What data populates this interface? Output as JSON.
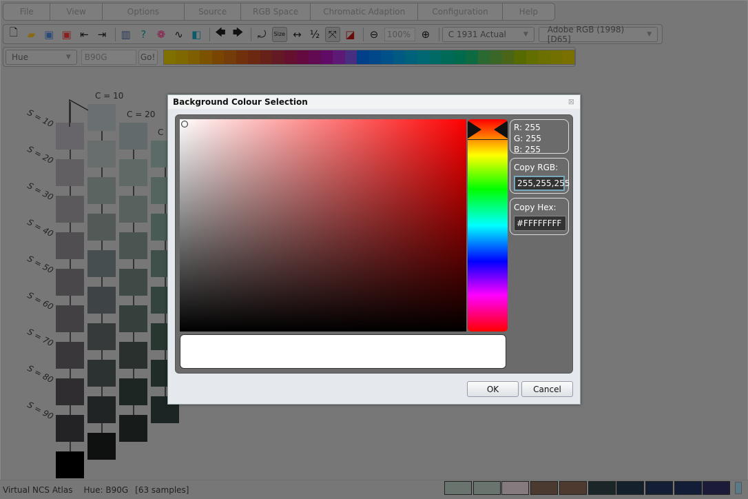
{
  "menu": [
    "File",
    "View",
    "Options",
    "Source",
    "RGB Space",
    "Chromatic Adaption",
    "Configuration",
    "Help"
  ],
  "toolbar": {
    "icons": [
      "new-file-icon",
      "open-folder-icon",
      "save-icon",
      "close-file-icon",
      "import-icon",
      "export-icon",
      "book-icon",
      "help-icon",
      "color-wheel-icon",
      "curve-icon",
      "split-swatch-icon",
      "arrow-left-icon",
      "arrow-right-icon",
      "rotate-icon",
      "size-icon",
      "fit-width-icon",
      "half-icon",
      "fullscreen-icon",
      "color-stack-icon",
      "zoom-out-icon",
      "zoom-in-icon"
    ],
    "zoom": "100%",
    "observer": "C 1931 Actual",
    "rgb_space": "Adobe RGB (1998) [D65]"
  },
  "hue_row": {
    "mode": "Hue",
    "value": "B90G",
    "go": "Go!",
    "strip": [
      "#807000",
      "#806800",
      "#7e5e00",
      "#7c5200",
      "#784600",
      "#743c08",
      "#70300c",
      "#6c2810",
      "#662218",
      "#641a24",
      "#64102e",
      "#640a40",
      "#620a52",
      "#600c66",
      "#5e1876",
      "#482e80",
      "#00408a",
      "#00488a",
      "#00508a",
      "#005a82",
      "#00627a",
      "#006872",
      "#006a66",
      "#006a58",
      "#006a4c",
      "#0e6a40",
      "#2a6a32",
      "#3a6628",
      "#4a6418",
      "#566a00",
      "#626e00",
      "#6c7000",
      "#727000",
      "#7a7000"
    ]
  },
  "atlas": {
    "c_labels": [
      "C = 10",
      "C = 20",
      "C"
    ],
    "s_labels": [
      "S = 10",
      "S = 20",
      "S = 30",
      "S = 40",
      "S = 50",
      "S = 60",
      "S = 70",
      "S = 80",
      "S = 90"
    ],
    "columns": [
      [
        "#676569",
        "#625f63",
        "#5c595d",
        "#514e52",
        "#4a474b",
        "#434044",
        "#3a373b",
        "#2f2d30",
        "#232225",
        "#000000"
      ],
      [
        "#6a6f71",
        "#686e6e",
        "#5c6461",
        "#525957",
        "#474e4f",
        "#3e4346",
        "#363a3a",
        "#2c3131",
        "#202424",
        "#0f1110"
      ],
      [
        "#626a6b",
        "#5f6966",
        "#58615e",
        "#4a5552",
        "#3f4946",
        "#353f3b",
        "#29302e",
        "#1e2624",
        "#171c1b"
      ],
      [
        "#5b6b67",
        "#546560",
        "#495b55",
        "#3f504a",
        "#33433e",
        "#28372f",
        "#1f2c28",
        "#1b2624"
      ]
    ]
  },
  "status": {
    "app": "Virtual NCS Atlas",
    "hue": "Hue: B90G",
    "samples": "[63 samples]",
    "swatches": [
      "#6a746e",
      "#6a746e",
      "#857a7d",
      "#4a3a30",
      "#4e3a2f",
      "#1b2628",
      "#14202c",
      "#141e34",
      "#131d37",
      "#1c1c3a"
    ]
  },
  "dialog": {
    "title": "Background Colour Selection",
    "r": "R: 255",
    "g": "G: 255",
    "b": "B: 255",
    "copy_rgb_label": "Copy RGB:",
    "rgb_value": "255,255,255",
    "copy_hex_label": "Copy Hex:",
    "hex_value": "#FFFFFFFF",
    "ok": "OK",
    "cancel": "Cancel",
    "selected_color": "#FFFFFF",
    "hue_color": "#FF0000"
  }
}
